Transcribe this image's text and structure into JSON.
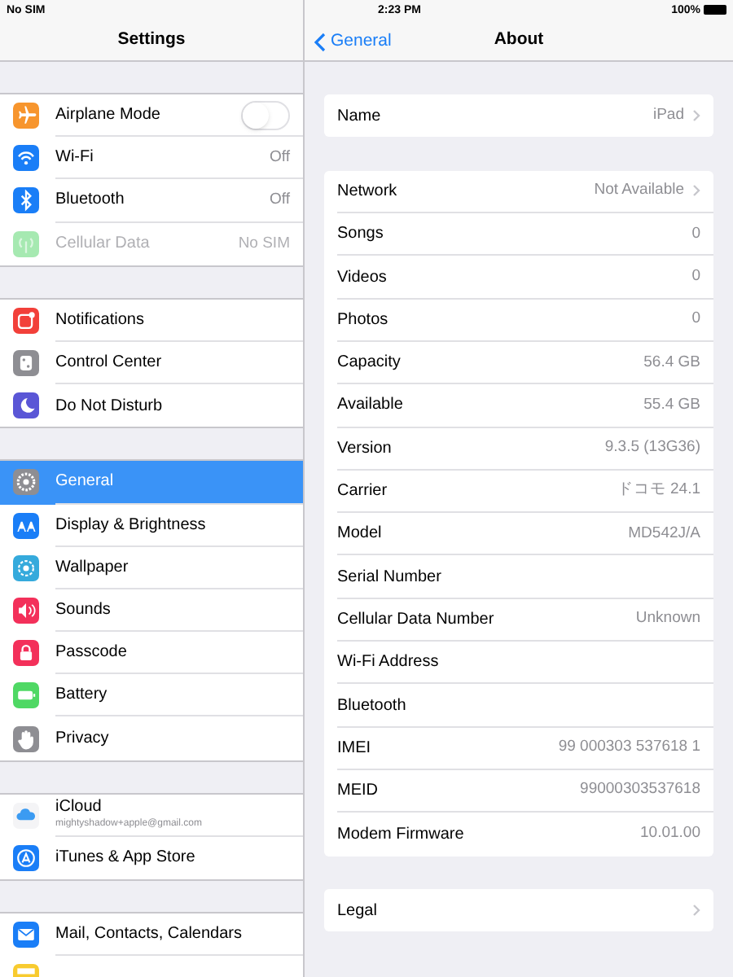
{
  "status_bar": {
    "carrier": "No SIM",
    "time": "2:23 PM",
    "battery": "100%"
  },
  "sidebar": {
    "title": "Settings",
    "groups": [
      {
        "items": [
          {
            "label": "Airplane Mode",
            "color": "#f7952d",
            "selected": false,
            "disabled": false,
            "on": false,
            "kind": "toggle"
          },
          {
            "label": "Wi-Fi",
            "value": "Off",
            "color": "#1a7ef7",
            "selected": false,
            "disabled": false,
            "kind": "value"
          },
          {
            "label": "Bluetooth",
            "value": "Off",
            "color": "#1a7ef7",
            "selected": false,
            "disabled": false,
            "kind": "value"
          },
          {
            "label": "Cellular Data",
            "value": "No SIM",
            "color": "#a6e9b1",
            "selected": false,
            "disabled": true,
            "kind": "value"
          }
        ]
      },
      {
        "items": [
          {
            "label": "Notifications",
            "color": "#f2403a",
            "selected": false,
            "disabled": false,
            "kind": "plain"
          },
          {
            "label": "Control Center",
            "color": "#8e8e93",
            "selected": false,
            "disabled": false,
            "kind": "plain"
          },
          {
            "label": "Do Not Disturb",
            "color": "#5a56d6",
            "selected": false,
            "disabled": false,
            "kind": "plain"
          }
        ]
      },
      {
        "items": [
          {
            "label": "General",
            "color": "#8e8e93",
            "selected": true,
            "disabled": false,
            "kind": "plain"
          },
          {
            "label": "Display & Brightness",
            "color": "#1a7ef7",
            "selected": false,
            "disabled": false,
            "kind": "plain"
          },
          {
            "label": "Wallpaper",
            "color": "#35aadc",
            "selected": false,
            "disabled": false,
            "kind": "plain"
          },
          {
            "label": "Sounds",
            "color": "#f3305a",
            "selected": false,
            "disabled": false,
            "kind": "plain"
          },
          {
            "label": "Passcode",
            "color": "#f3305a",
            "selected": false,
            "disabled": false,
            "kind": "plain"
          },
          {
            "label": "Battery",
            "color": "#4fd864",
            "selected": false,
            "disabled": false,
            "kind": "plain"
          },
          {
            "label": "Privacy",
            "color": "#8e8e93",
            "selected": false,
            "disabled": false,
            "kind": "plain"
          }
        ]
      },
      {
        "items": [
          {
            "label": "iCloud",
            "subtitle": "mightyshadow+apple@gmail.com",
            "color": "#f4f4f6",
            "selected": false,
            "disabled": false,
            "kind": "account"
          },
          {
            "label": "iTunes & App Store",
            "color": "#1a7ef7",
            "selected": false,
            "disabled": false,
            "kind": "plain"
          }
        ]
      },
      {
        "items": [
          {
            "label": "Mail, Contacts, Calendars",
            "color": "#1a7ef7",
            "selected": false,
            "disabled": false,
            "kind": "plain"
          },
          {
            "color": "#f8cb2f",
            "selected": false,
            "disabled": false,
            "kind": "plain"
          }
        ]
      }
    ]
  },
  "detail": {
    "back": "General",
    "title": "About",
    "groups": [
      {
        "rows": [
          {
            "label": "Name",
            "value": "iPad",
            "kind": "link"
          }
        ]
      },
      {
        "rows": [
          {
            "label": "Network",
            "value": "Not Available",
            "kind": "link"
          },
          {
            "label": "Songs",
            "value": "0",
            "kind": "info"
          },
          {
            "label": "Videos",
            "value": "0",
            "kind": "info"
          },
          {
            "label": "Photos",
            "value": "0",
            "kind": "info"
          },
          {
            "label": "Capacity",
            "value": "56.4 GB",
            "kind": "info"
          },
          {
            "label": "Available",
            "value": "55.4 GB",
            "kind": "info"
          },
          {
            "label": "Version",
            "value": "9.3.5 (13G36)",
            "kind": "info"
          },
          {
            "label": "Carrier",
            "value": "ドコモ 24.1",
            "kind": "info"
          },
          {
            "label": "Model",
            "value": "MD542J/A",
            "kind": "info"
          },
          {
            "label": "Serial Number",
            "kind": "info"
          },
          {
            "label": "Cellular Data Number",
            "value": "Unknown",
            "kind": "info"
          },
          {
            "label": "Wi-Fi Address",
            "kind": "info"
          },
          {
            "label": "Bluetooth",
            "kind": "info"
          },
          {
            "label": "IMEI",
            "value": "99 000303 537618 1",
            "kind": "info"
          },
          {
            "label": "MEID",
            "value": "99000303537618",
            "kind": "info"
          },
          {
            "label": "Modem Firmware",
            "value": "10.01.00",
            "kind": "info"
          }
        ]
      },
      {
        "rows": [
          {
            "label": "Legal",
            "kind": "link"
          }
        ]
      }
    ]
  }
}
